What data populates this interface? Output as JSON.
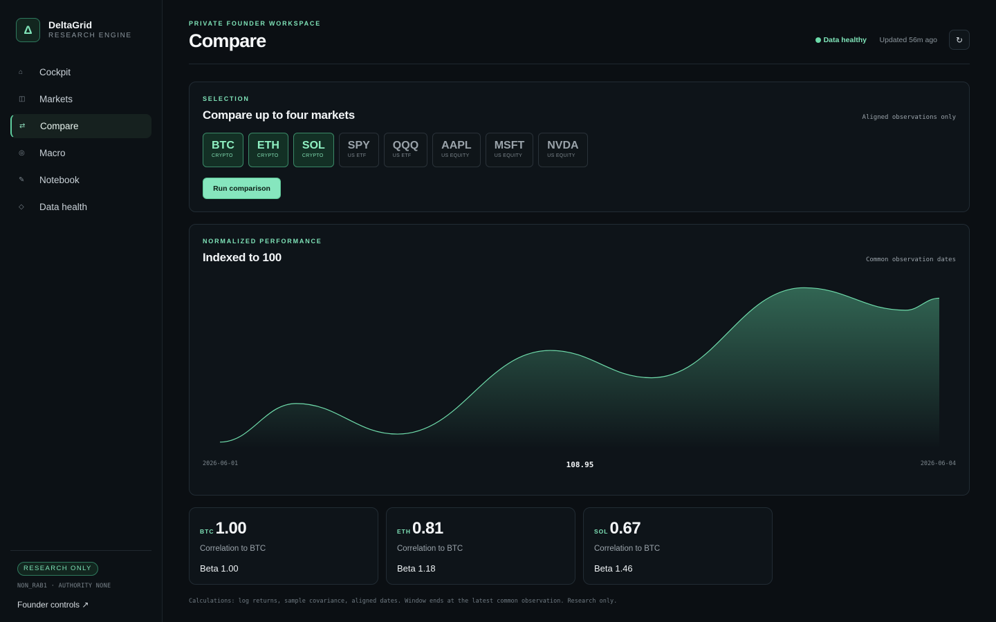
{
  "brand": {
    "logo_glyph": "Δ",
    "name": "DeltaGrid",
    "subtitle": "RESEARCH ENGINE"
  },
  "nav": [
    {
      "label": "Cockpit",
      "icon": "⌂",
      "icon_name": "home-icon",
      "active": false
    },
    {
      "label": "Markets",
      "icon": "◫",
      "icon_name": "markets-icon",
      "active": false
    },
    {
      "label": "Compare",
      "icon": "⇄",
      "icon_name": "compare-icon",
      "active": true
    },
    {
      "label": "Macro",
      "icon": "◎",
      "icon_name": "macro-icon",
      "active": false
    },
    {
      "label": "Notebook",
      "icon": "✎",
      "icon_name": "notebook-icon",
      "active": false
    },
    {
      "label": "Data health",
      "icon": "◇",
      "icon_name": "data-health-icon",
      "active": false
    }
  ],
  "sidebar_footer": {
    "badge": "RESEARCH ONLY",
    "meta": "NON_RAB1 · AUTHORITY NONE",
    "founder_link": "Founder controls ↗"
  },
  "header": {
    "eyebrow": "PRIVATE FOUNDER WORKSPACE",
    "title": "Compare",
    "status": "Data healthy",
    "updated": "Updated 56m ago",
    "refresh_icon": "↻"
  },
  "selection": {
    "eyebrow": "SELECTION",
    "title": "Compare up to four markets",
    "note": "Aligned observations only",
    "chips": [
      {
        "symbol": "BTC",
        "class": "CRYPTO",
        "selected": true
      },
      {
        "symbol": "ETH",
        "class": "CRYPTO",
        "selected": true
      },
      {
        "symbol": "SOL",
        "class": "CRYPTO",
        "selected": true
      },
      {
        "symbol": "SPY",
        "class": "US ETF",
        "selected": false
      },
      {
        "symbol": "QQQ",
        "class": "US ETF",
        "selected": false
      },
      {
        "symbol": "AAPL",
        "class": "US EQUITY",
        "selected": false
      },
      {
        "symbol": "MSFT",
        "class": "US EQUITY",
        "selected": false
      },
      {
        "symbol": "NVDA",
        "class": "US EQUITY",
        "selected": false
      }
    ],
    "run_button": "Run comparison"
  },
  "performance": {
    "eyebrow": "NORMALIZED PERFORMANCE",
    "title": "Indexed to 100",
    "note": "Common observation dates",
    "x_start": "2026-06-01",
    "x_end": "2026-06-04",
    "current_value": "108.95"
  },
  "chart_data": {
    "type": "area",
    "x_range": [
      "2026-06-01",
      "2026-06-04"
    ],
    "points": [
      {
        "t": 0.0,
        "y": 100.0
      },
      {
        "t": 0.106,
        "y": 102.4
      },
      {
        "t": 0.247,
        "y": 100.5
      },
      {
        "t": 0.459,
        "y": 105.7
      },
      {
        "t": 0.6,
        "y": 104.0
      },
      {
        "t": 0.812,
        "y": 109.6
      },
      {
        "t": 0.953,
        "y": 108.2
      },
      {
        "t": 1.0,
        "y": 108.95
      }
    ],
    "ylim": [
      99.6,
      110.0
    ],
    "color": "#6fdcab"
  },
  "stats": [
    {
      "ticker": "BTC",
      "value": "1.00",
      "label": "Correlation to BTC",
      "beta": "Beta 1.00"
    },
    {
      "ticker": "ETH",
      "value": "0.81",
      "label": "Correlation to BTC",
      "beta": "Beta 1.18"
    },
    {
      "ticker": "SOL",
      "value": "0.67",
      "label": "Correlation to BTC",
      "beta": "Beta 1.46"
    }
  ],
  "footnote": "Calculations: log returns, sample covariance, aligned dates. Window ends at the latest common observation. Research only.",
  "colors": {
    "accent": "#7fe3b8",
    "background": "#0b0f13",
    "card": "#0e1419"
  }
}
